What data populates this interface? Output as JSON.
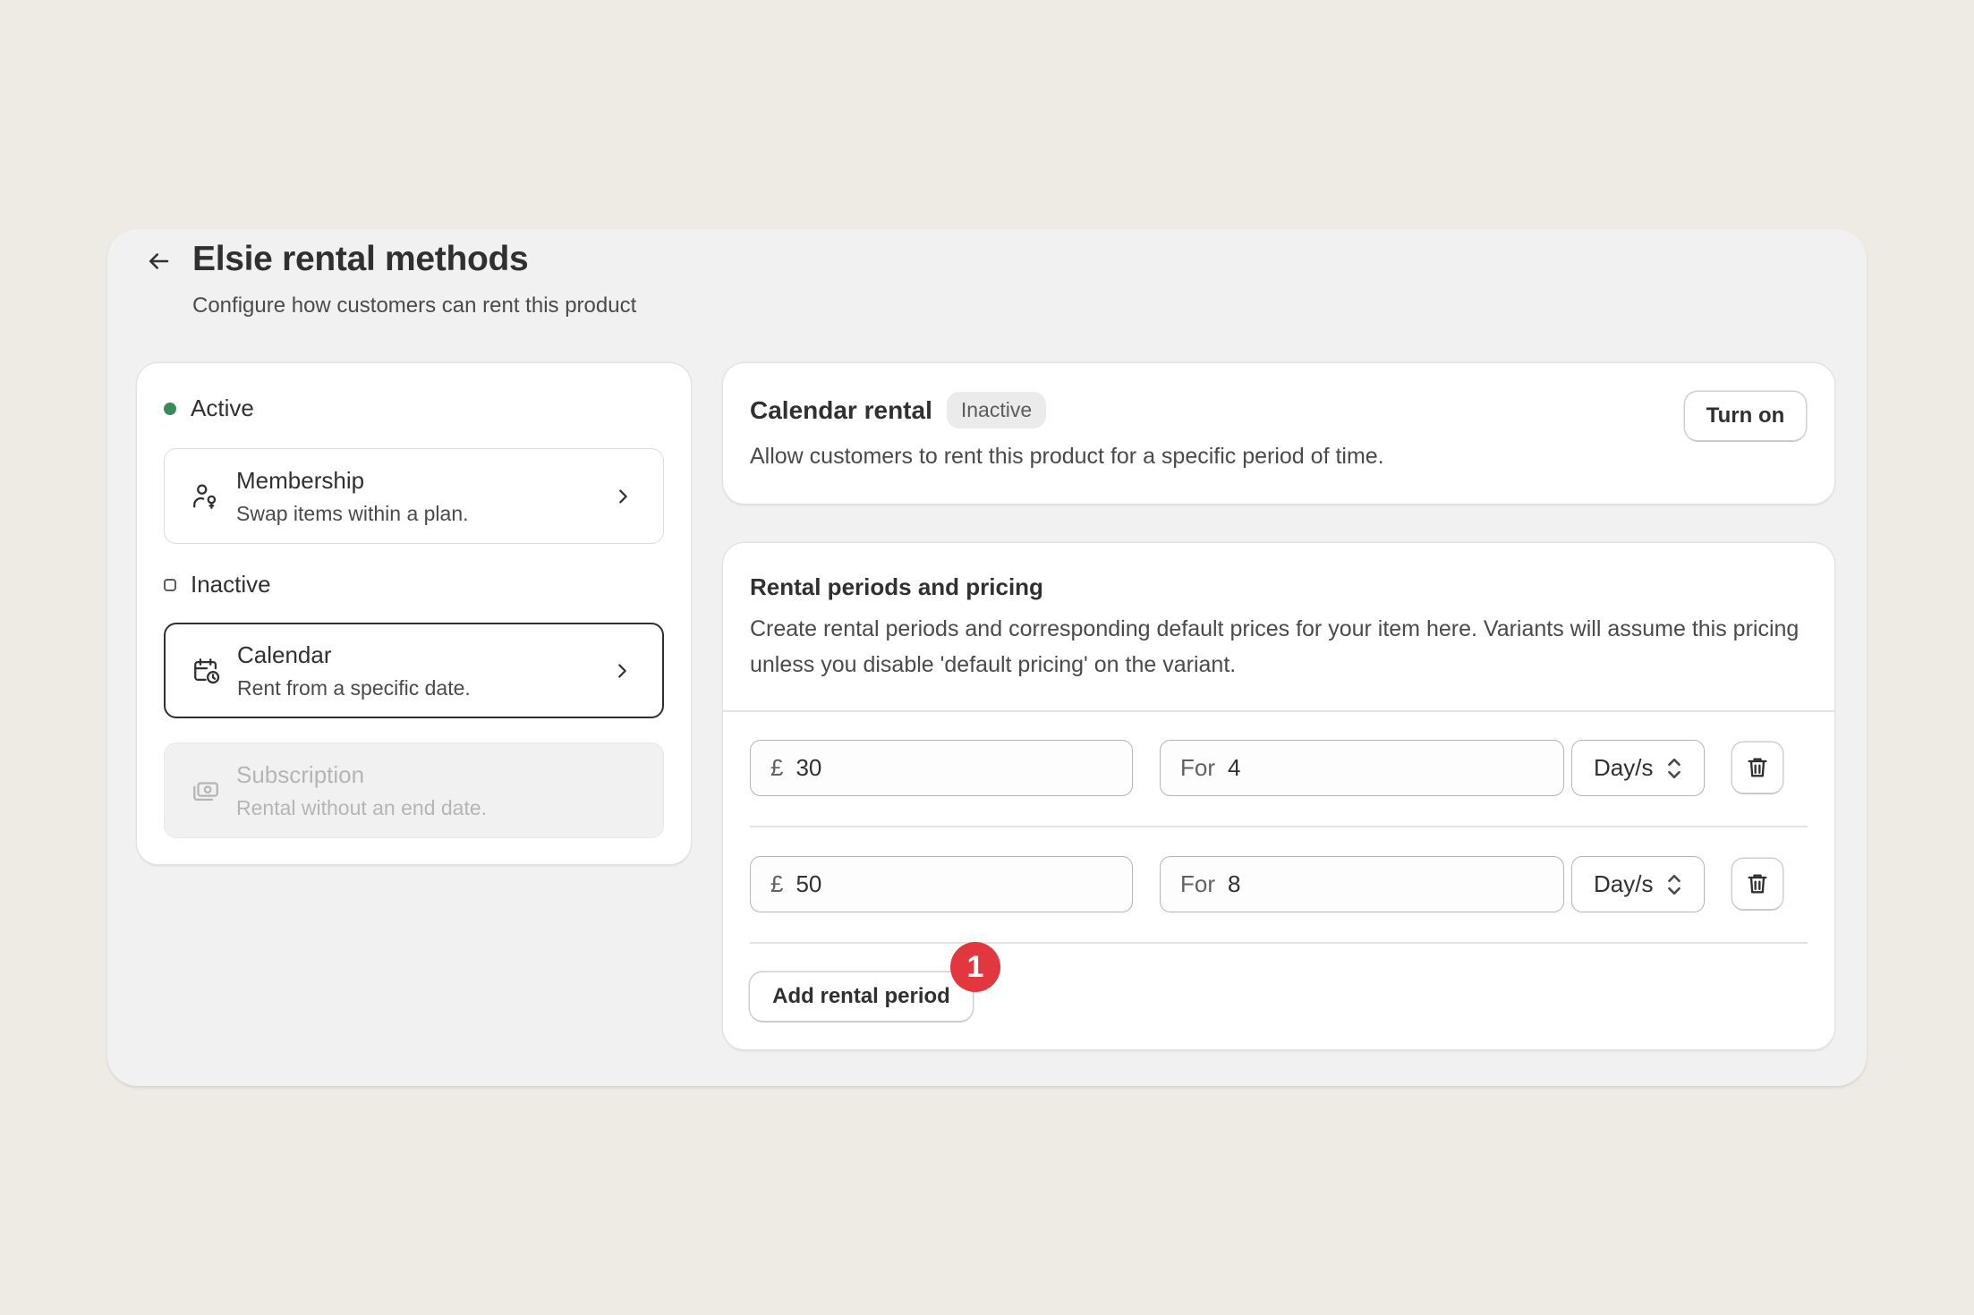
{
  "header": {
    "title": "Elsie rental methods",
    "subtitle": "Configure how customers can rent this product"
  },
  "methods_panel": {
    "active_label": "Active",
    "inactive_label": "Inactive",
    "methods": [
      {
        "title": "Membership",
        "description": "Swap items within a plan.",
        "icon": "membership-icon",
        "state": "active"
      },
      {
        "title": "Calendar",
        "description": "Rent from a specific date.",
        "icon": "calendar-clock-icon",
        "state": "selected"
      },
      {
        "title": "Subscription",
        "description": "Rental without an end date.",
        "icon": "subscription-icon",
        "state": "disabled"
      }
    ]
  },
  "calendar_rental": {
    "title": "Calendar rental",
    "status_badge": "Inactive",
    "description": "Allow customers to rent this product for a specific period of time.",
    "turn_on_label": "Turn on"
  },
  "pricing": {
    "title": "Rental periods and pricing",
    "description": "Create rental periods and corresponding default prices for your item here. Variants will assume this pricing unless you disable 'default pricing' on the variant.",
    "rows": [
      {
        "currency": "£",
        "price": "30",
        "for_label": "For",
        "duration": "4",
        "unit": "Day/s"
      },
      {
        "currency": "£",
        "price": "50",
        "for_label": "For",
        "duration": "8",
        "unit": "Day/s"
      }
    ],
    "add_label": "Add rental period",
    "notification_count": "1"
  },
  "colors": {
    "background": "#eeebe5",
    "active_dot": "#3a8a5c",
    "notification": "#e2373f"
  }
}
